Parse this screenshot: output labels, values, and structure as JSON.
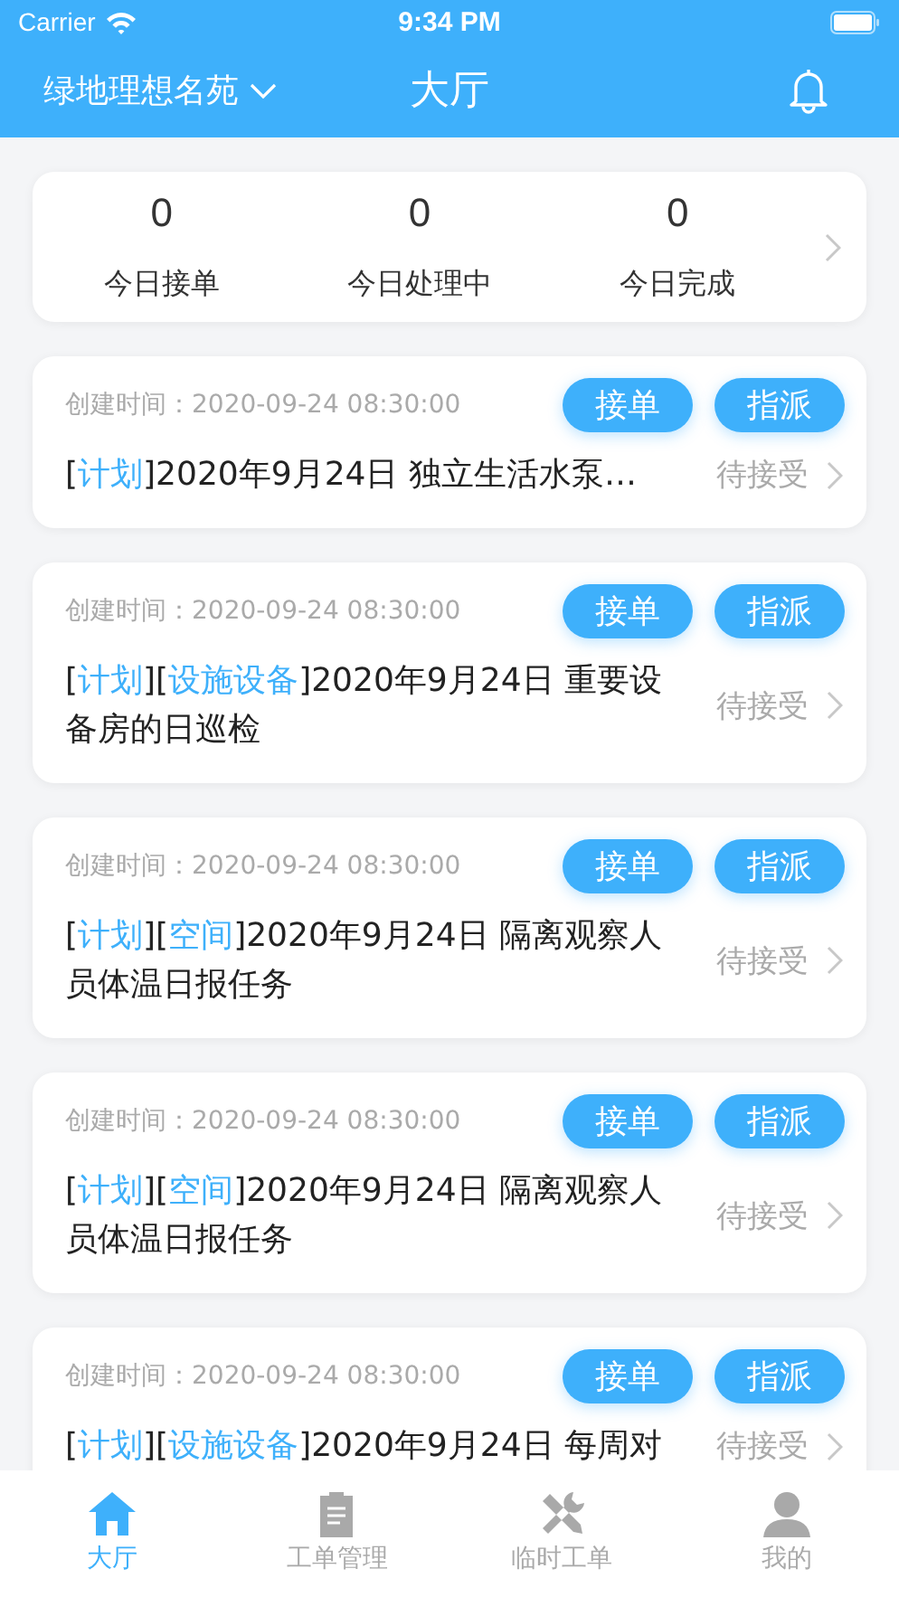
{
  "status_bar": {
    "carrier": "Carrier",
    "time": "9:34 PM"
  },
  "header": {
    "location": "绿地理想名苑",
    "title": "大厅"
  },
  "stats": [
    {
      "value": "0",
      "label": "今日接单"
    },
    {
      "value": "0",
      "label": "今日处理中"
    },
    {
      "value": "0",
      "label": "今日完成"
    }
  ],
  "orders": [
    {
      "created": "创建时间：2020-09-24 08:30:00",
      "buttons": [
        "接单",
        "指派"
      ],
      "title_parts": [
        {
          "kind": "plain",
          "text": "["
        },
        {
          "kind": "tag",
          "text": "计划"
        },
        {
          "kind": "plain",
          "text": "]2020年9月24日 独立生活水泵…"
        }
      ],
      "status": "待接受"
    },
    {
      "created": "创建时间：2020-09-24 08:30:00",
      "buttons": [
        "接单",
        "指派"
      ],
      "title_parts": [
        {
          "kind": "plain",
          "text": "["
        },
        {
          "kind": "tag",
          "text": "计划"
        },
        {
          "kind": "plain",
          "text": "]["
        },
        {
          "kind": "tag",
          "text": "设施设备"
        },
        {
          "kind": "plain",
          "text": "]2020年9月24日 重要设备房的日巡检"
        }
      ],
      "status": "待接受"
    },
    {
      "created": "创建时间：2020-09-24 08:30:00",
      "buttons": [
        "接单",
        "指派"
      ],
      "title_parts": [
        {
          "kind": "plain",
          "text": "["
        },
        {
          "kind": "tag",
          "text": "计划"
        },
        {
          "kind": "plain",
          "text": "]["
        },
        {
          "kind": "tag",
          "text": "空间"
        },
        {
          "kind": "plain",
          "text": "]2020年9月24日 隔离观察人员体温日报任务"
        }
      ],
      "status": "待接受"
    },
    {
      "created": "创建时间：2020-09-24 08:30:00",
      "buttons": [
        "接单",
        "指派"
      ],
      "title_parts": [
        {
          "kind": "plain",
          "text": "["
        },
        {
          "kind": "tag",
          "text": "计划"
        },
        {
          "kind": "plain",
          "text": "]["
        },
        {
          "kind": "tag",
          "text": "空间"
        },
        {
          "kind": "plain",
          "text": "]2020年9月24日 隔离观察人员体温日报任务"
        }
      ],
      "status": "待接受"
    },
    {
      "created": "创建时间：2020-09-24 08:30:00",
      "buttons": [
        "接单",
        "指派"
      ],
      "title_parts": [
        {
          "kind": "plain",
          "text": "["
        },
        {
          "kind": "tag",
          "text": "计划"
        },
        {
          "kind": "plain",
          "text": "]["
        },
        {
          "kind": "tag",
          "text": "设施设备"
        },
        {
          "kind": "plain",
          "text": "]2020年9月24日 每周对"
        }
      ],
      "status": "待接受"
    }
  ],
  "tabs": [
    {
      "label": "大厅",
      "kind": "home",
      "selected": true
    },
    {
      "label": "工单管理",
      "kind": "clipboard",
      "selected": false
    },
    {
      "label": "临时工单",
      "kind": "tools",
      "selected": false
    },
    {
      "label": "我的",
      "kind": "person",
      "selected": false
    }
  ]
}
